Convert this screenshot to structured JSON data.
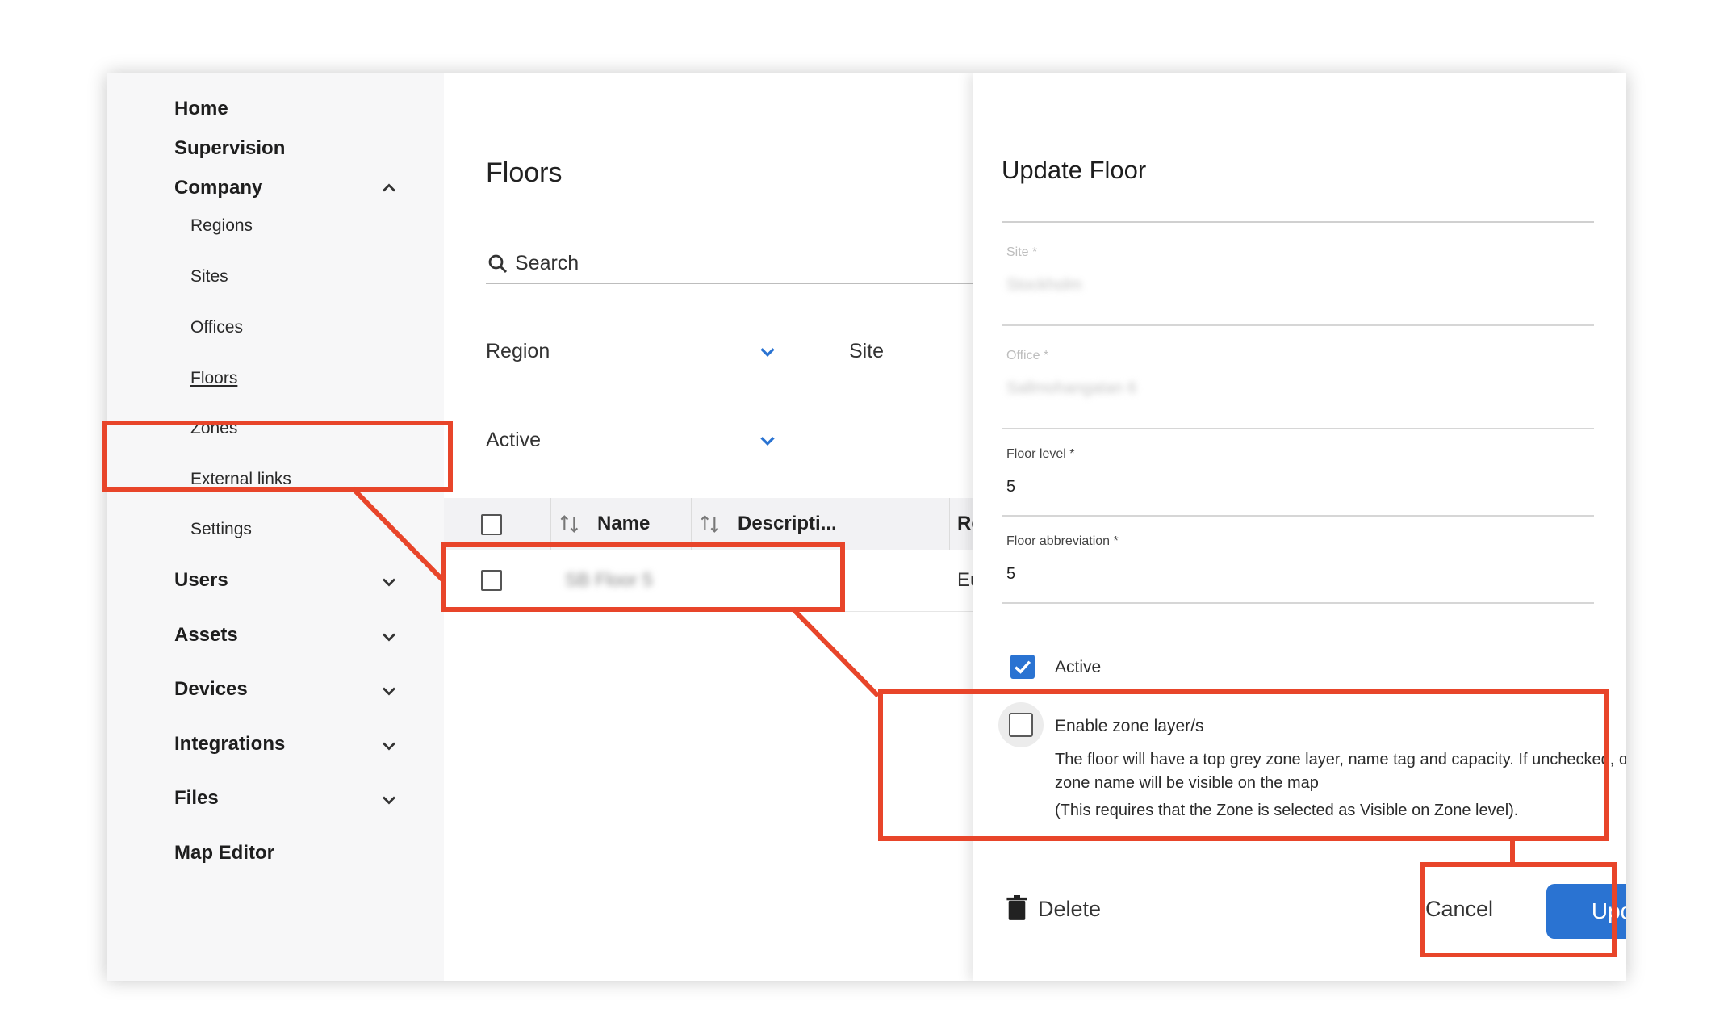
{
  "sidebar": {
    "items": {
      "home": "Home",
      "supervision": "Supervision",
      "company": "Company",
      "users": "Users",
      "assets": "Assets",
      "devices": "Devices",
      "integrations": "Integrations",
      "files": "Files",
      "map_editor": "Map Editor"
    },
    "company_sub": {
      "regions": "Regions",
      "sites": "Sites",
      "offices": "Offices",
      "floors": "Floors",
      "zones": "Zones",
      "external_links": "External links",
      "settings": "Settings"
    }
  },
  "main": {
    "title": "Floors",
    "search_label": "Search",
    "filters": {
      "region": "Region",
      "site": "Site",
      "active": "Active"
    },
    "table": {
      "col_name": "Name",
      "col_description": "Descripti...",
      "col_region": "Re",
      "row_name": "SB Floor 5",
      "row_region": "Eu"
    }
  },
  "drawer": {
    "title": "Update Floor",
    "site_label": "Site *",
    "site_value": "Stockholm",
    "office_label": "Office *",
    "office_value": "Sallmohangatan 6",
    "floor_level_label": "Floor level *",
    "floor_level_value": "5",
    "floor_abbr_label": "Floor abbreviation *",
    "floor_abbr_value": "5",
    "active_label": "Active",
    "zone_layer_label": "Enable zone layer/s",
    "zone_layer_desc": "The floor will have a top grey zone layer, name tag and capacity. If unchecked, only the zone name will be visible on the map",
    "zone_layer_note": "(This requires that the Zone is selected as Visible on Zone level).",
    "delete_label": "Delete",
    "cancel_label": "Cancel",
    "update_label": "Update"
  },
  "colors": {
    "accent": "#2a73d2",
    "annotation": "#e8452a"
  }
}
